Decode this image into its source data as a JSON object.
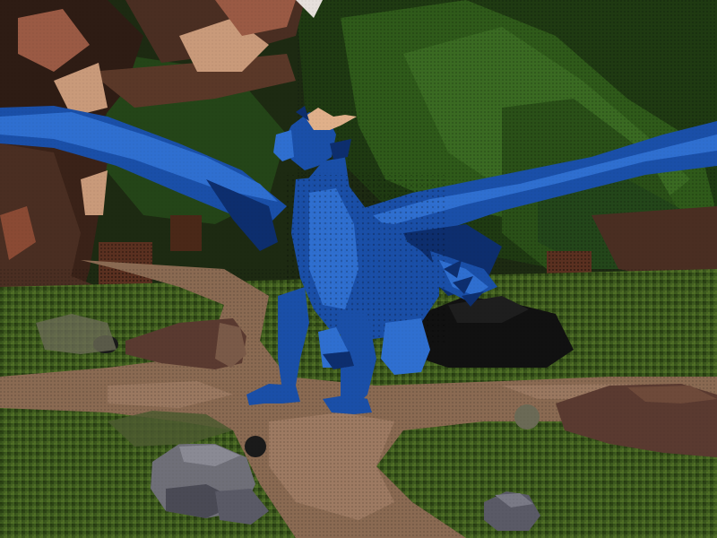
{
  "scene": {
    "setting": "forest-clearing",
    "subject": "blue-dragon",
    "colors": {
      "sky_dark": "#1d2a12",
      "grass": "#3d5a1e",
      "grass_dark": "#2b4214",
      "path": "#8a6a52",
      "path_light": "#a5826a",
      "foliage_dark": "#1f3a12",
      "foliage": "#2f5a1a",
      "foliage_light": "#4a7a2a",
      "trunk": "#4a2e22",
      "trunk_dark": "#2e1c14",
      "leaves_autumn": "#9a5a44",
      "leaves_autumn_light": "#c99a7a",
      "rock": "#6f6f78",
      "rock_dark": "#4a4a55",
      "boulder_brown": "#5a3a30",
      "dragon_blue": "#1a4fa8",
      "dragon_blue_light": "#2f6fd0",
      "dragon_blue_dark": "#0d2e6e",
      "dragon_horn": "#e0b08a"
    }
  }
}
